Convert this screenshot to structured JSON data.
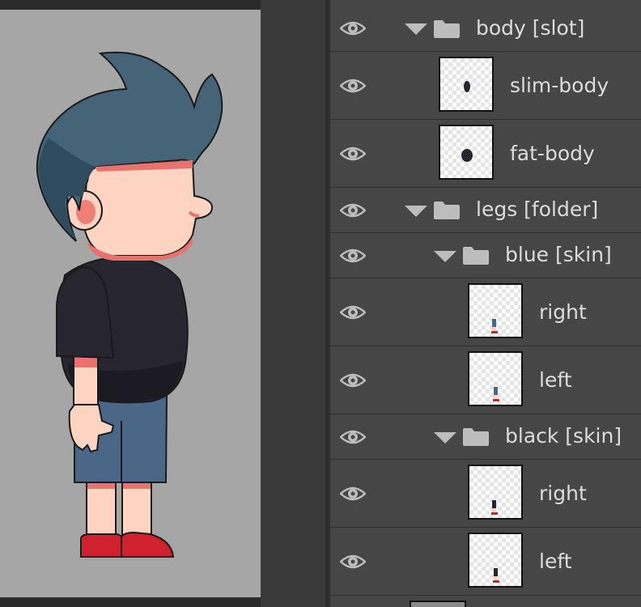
{
  "colors": {
    "panel_bg": "#464646",
    "canvas_bg": "#a6a6a6",
    "text": "#dcdcdc",
    "icon": "#bdbdbd",
    "hair": "#456477",
    "skin": "#fdd4c2",
    "shirt": "#27252f",
    "shorts": "#4a6787",
    "shoes": "#d0222e"
  },
  "icons": {
    "visibility": "eye-icon",
    "expand": "caret-down-icon",
    "group": "folder-icon"
  },
  "layers": [
    {
      "name": "body [slot]",
      "type": "group",
      "visible": true,
      "expanded": true
    },
    {
      "name": "slim-body",
      "type": "layer",
      "visible": true
    },
    {
      "name": "fat-body",
      "type": "layer",
      "visible": true
    },
    {
      "name": "legs [folder]",
      "type": "group",
      "visible": true,
      "expanded": true
    },
    {
      "name": "blue [skin]",
      "type": "group",
      "visible": true,
      "expanded": true
    },
    {
      "name": "right",
      "type": "layer",
      "visible": true
    },
    {
      "name": "left",
      "type": "layer",
      "visible": true
    },
    {
      "name": "black [skin]",
      "type": "group",
      "visible": true,
      "expanded": true
    },
    {
      "name": "right",
      "type": "layer",
      "visible": true
    },
    {
      "name": "left",
      "type": "layer",
      "visible": true
    }
  ]
}
